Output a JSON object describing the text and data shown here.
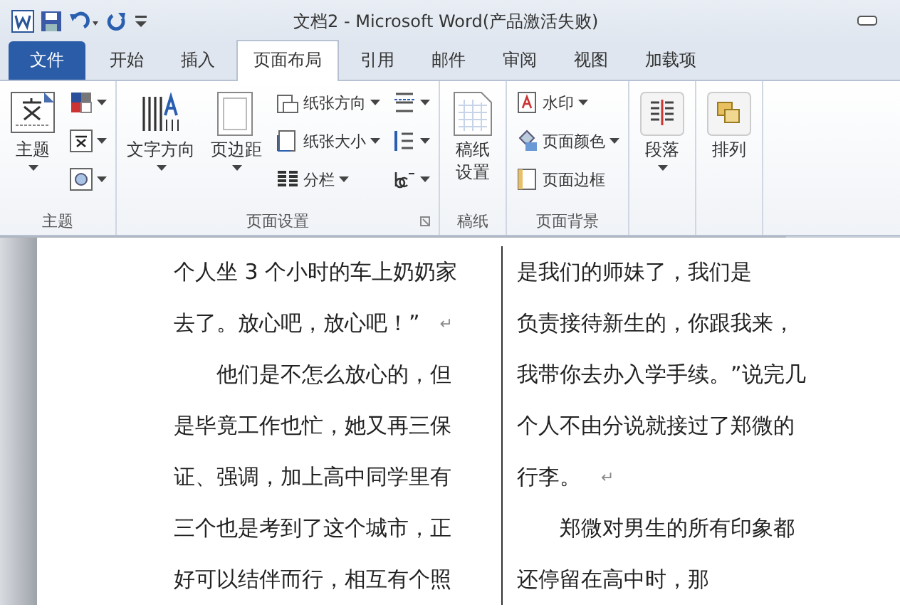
{
  "window": {
    "title": "文档2 - Microsoft Word(产品激活失败)"
  },
  "tabs": [
    {
      "label": "文件",
      "kind": "file",
      "selected": false
    },
    {
      "label": "开始",
      "kind": "tab",
      "selected": false
    },
    {
      "label": "插入",
      "kind": "tab",
      "selected": false
    },
    {
      "label": "页面布局",
      "kind": "tab",
      "selected": true
    },
    {
      "label": "引用",
      "kind": "tab",
      "selected": false
    },
    {
      "label": "邮件",
      "kind": "tab",
      "selected": false
    },
    {
      "label": "审阅",
      "kind": "tab",
      "selected": false
    },
    {
      "label": "视图",
      "kind": "tab",
      "selected": false
    },
    {
      "label": "加载项",
      "kind": "tab",
      "selected": false
    }
  ],
  "ribbon": {
    "groups": [
      {
        "label": "主题",
        "columns": [
          [
            {
              "kind": "large",
              "label": "主题",
              "dropdown": true
            }
          ],
          [
            {
              "kind": "small",
              "dropdown": true
            },
            {
              "kind": "small",
              "dropdown": true
            },
            {
              "kind": "small",
              "dropdown": true
            }
          ]
        ]
      },
      {
        "label": "页面设置",
        "launcher": true,
        "columns": [
          [
            {
              "kind": "large",
              "label": "文字方向",
              "dropdown": true
            }
          ],
          [
            {
              "kind": "large",
              "label": "页边距",
              "dropdown": true
            }
          ],
          [
            {
              "kind": "small",
              "label": "纸张方向",
              "dropdown": true
            },
            {
              "kind": "small",
              "label": "纸张大小",
              "dropdown": true
            },
            {
              "kind": "small",
              "label": "分栏",
              "dropdown": true
            }
          ],
          [
            {
              "kind": "small",
              "dropdown": true
            },
            {
              "kind": "small",
              "dropdown": true
            },
            {
              "kind": "small",
              "dropdown": true
            }
          ]
        ]
      },
      {
        "label": "稿纸",
        "columns": [
          [
            {
              "kind": "large",
              "label": "稿纸设置",
              "dropdown": false
            }
          ]
        ]
      },
      {
        "label": "页面背景",
        "columns": [
          [
            {
              "kind": "small",
              "label": "水印",
              "dropdown": true
            },
            {
              "kind": "small",
              "label": "页面颜色",
              "dropdown": true
            },
            {
              "kind": "small",
              "label": "页面边框",
              "dropdown": false
            }
          ]
        ]
      },
      {
        "columns": [
          [
            {
              "kind": "large",
              "label": "段落",
              "dropdown": true
            }
          ]
        ]
      },
      {
        "columns": [
          [
            {
              "kind": "large",
              "label": "排列",
              "dropdown": false
            }
          ]
        ]
      }
    ]
  },
  "document": {
    "columns": [
      {
        "lines": [
          {
            "text": "个人坐 3 个小时的车上奶奶家"
          },
          {
            "text": "去了。放心吧，放心吧！”",
            "mark": "↵"
          },
          {
            "text": "　　他们是不怎么放心的，但"
          },
          {
            "text": "是毕竟工作也忙，她又再三保"
          },
          {
            "text": "证、强调，加上高中同学里有"
          },
          {
            "text": "三个也是考到了这个城市，正"
          },
          {
            "text": "好可以结伴而行，相互有个照"
          }
        ]
      },
      {
        "lines": [
          {
            "text": "是我们的师妹了，我们是"
          },
          {
            "text": "负责接待新生的，你跟我来，"
          },
          {
            "text": "我带你去办入学手续。”说完几"
          },
          {
            "text": "个人不由分说就接过了郑微的"
          },
          {
            "text": "行李。",
            "mark": "↵"
          },
          {
            "text": "　　郑微对男生的所有印象都"
          },
          {
            "text": "还停留在高中时，那"
          }
        ]
      }
    ]
  }
}
